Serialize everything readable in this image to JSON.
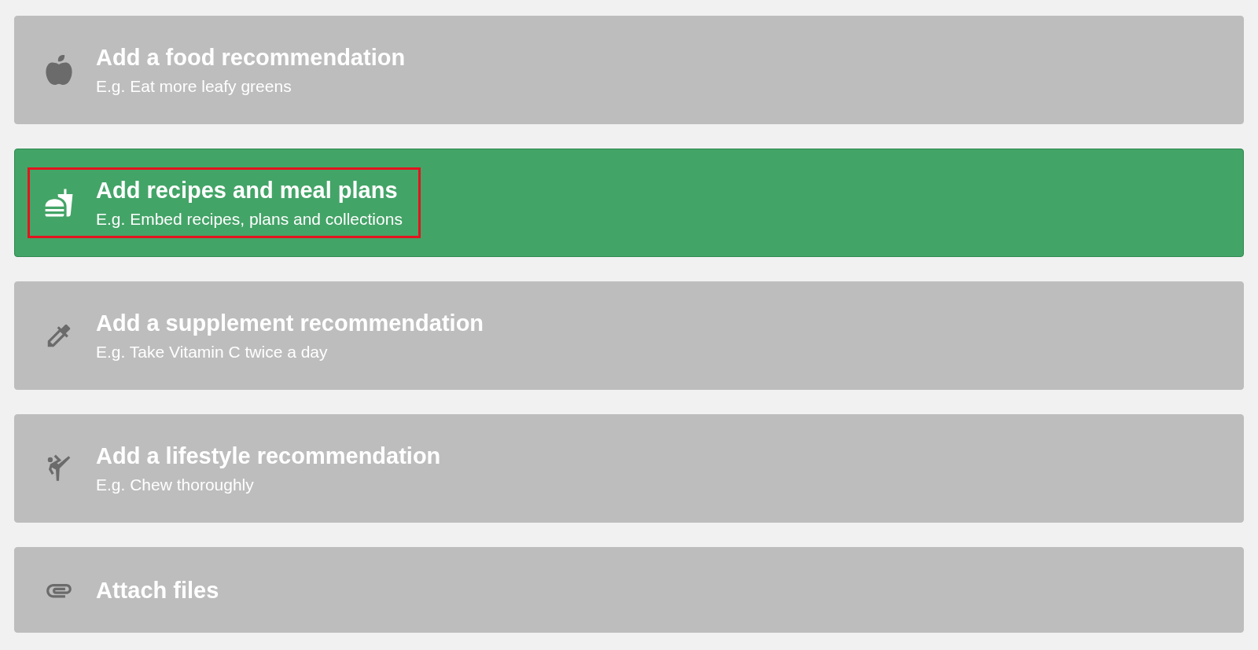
{
  "options": [
    {
      "kind": "food",
      "title": "Add a food recommendation",
      "subtitle": "E.g. Eat more leafy greens",
      "selected": false,
      "outlined": false
    },
    {
      "kind": "recipes",
      "title": "Add recipes and meal plans",
      "subtitle": "E.g. Embed recipes, plans and collections",
      "selected": true,
      "outlined": true
    },
    {
      "kind": "supplement",
      "title": "Add a supplement recommendation",
      "subtitle": "E.g. Take Vitamin C twice a day",
      "selected": false,
      "outlined": false
    },
    {
      "kind": "lifestyle",
      "title": "Add a lifestyle recommendation",
      "subtitle": "E.g. Chew thoroughly",
      "selected": false,
      "outlined": false
    },
    {
      "kind": "files",
      "title": "Attach files",
      "selected": false,
      "outlined": false
    }
  ]
}
